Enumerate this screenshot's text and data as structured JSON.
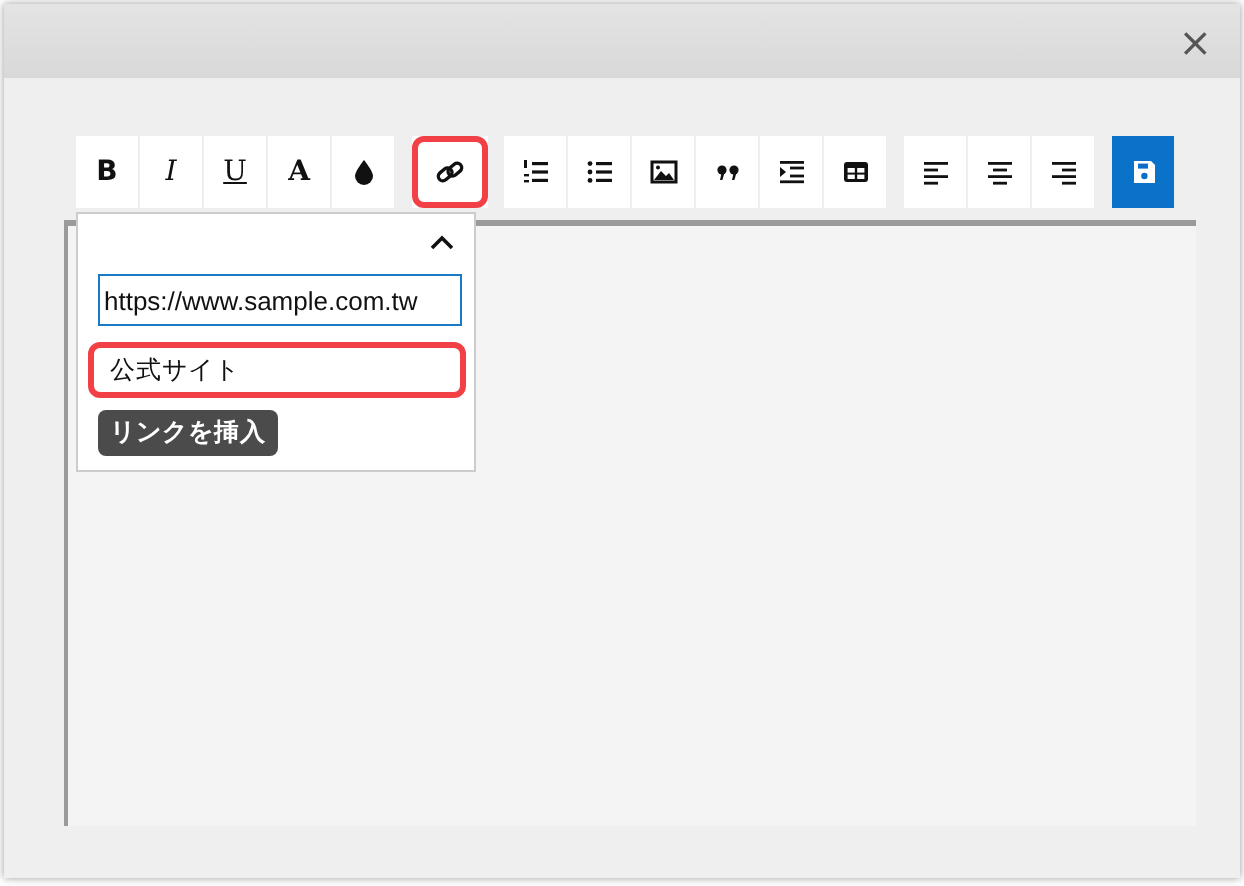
{
  "window": {
    "close": "×"
  },
  "toolbar": {
    "groups": [
      [
        {
          "kind": "bold",
          "label": "B",
          "highlighted": false
        },
        {
          "kind": "italic",
          "label": "I",
          "highlighted": false
        },
        {
          "kind": "underline",
          "label": "U",
          "highlighted": false
        },
        {
          "kind": "letter",
          "label": "A",
          "highlighted": false
        },
        {
          "kind": "drop",
          "highlighted": false
        }
      ],
      [
        {
          "kind": "link",
          "highlighted": true
        }
      ],
      [
        {
          "kind": "ordered-list",
          "highlighted": false
        },
        {
          "kind": "bullet-list",
          "highlighted": false
        },
        {
          "kind": "image",
          "highlighted": false
        },
        {
          "kind": "quote",
          "highlighted": false
        },
        {
          "kind": "indent",
          "highlighted": false
        },
        {
          "kind": "table",
          "highlighted": false
        }
      ],
      [
        {
          "kind": "align-left",
          "highlighted": false
        },
        {
          "kind": "align-center",
          "highlighted": false
        },
        {
          "kind": "align-right",
          "highlighted": false
        }
      ],
      [
        {
          "kind": "save",
          "highlighted": false
        }
      ]
    ]
  },
  "link_popup": {
    "url": {
      "value": "https://www.sample.com.tw",
      "focused": true,
      "highlighted": false
    },
    "text": {
      "value": "公式サイト",
      "highlighted": true
    },
    "insert_button": "リンクを挿入"
  }
}
